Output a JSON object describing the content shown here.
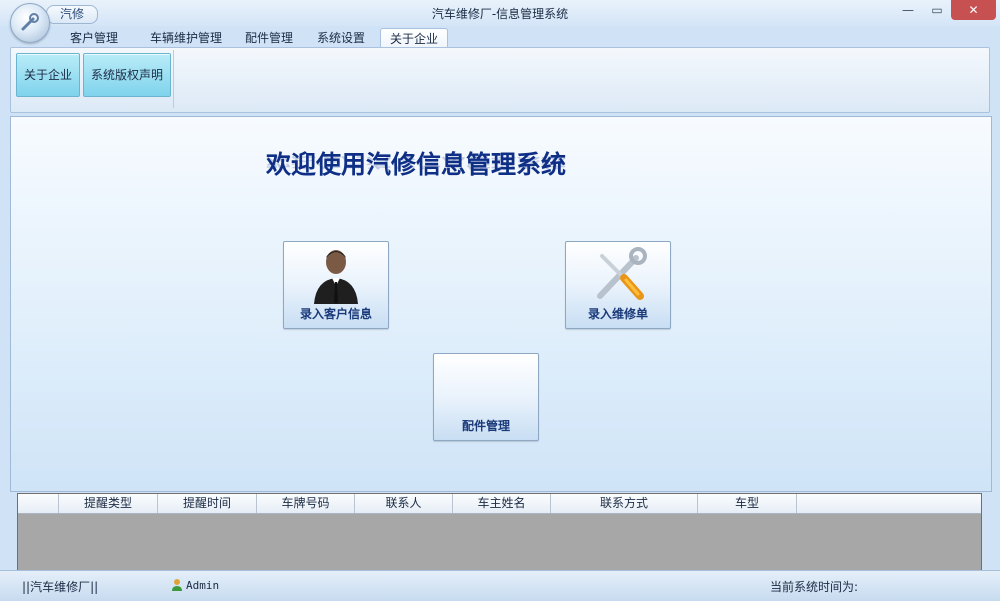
{
  "window": {
    "title": "汽车维修厂-信息管理系统",
    "quick_access_label": "汽修",
    "minimize_symbol": "—",
    "maximize_symbol": "▭",
    "close_symbol": "✕"
  },
  "tabs": [
    {
      "label": "客户管理",
      "active": false
    },
    {
      "label": "车辆维护管理",
      "active": false
    },
    {
      "label": "配件管理",
      "active": false
    },
    {
      "label": "系统设置",
      "active": false
    },
    {
      "label": "关于企业",
      "active": true
    }
  ],
  "ribbon": {
    "buttons": [
      {
        "label": "关于企业"
      },
      {
        "label": "系统版权声明"
      }
    ]
  },
  "main": {
    "welcome": "欢迎使用汽修信息管理系统",
    "buttons": [
      {
        "label": "录入客户信息",
        "icon": "businessman-icon"
      },
      {
        "label": "录入维修单",
        "icon": "tools-icon"
      },
      {
        "label": "配件管理",
        "icon": ""
      }
    ]
  },
  "grid": {
    "columns": [
      "提醒类型",
      "提醒时间",
      "车牌号码",
      "联系人",
      "车主姓名",
      "联系方式",
      "车型"
    ]
  },
  "status": {
    "company": "||汽车维修厂||",
    "user": "Admin",
    "time_label": "当前系统时间为:"
  },
  "colors": {
    "accent": "#0f2f86",
    "ribbon_button": "#7fd3ec",
    "close_button": "#c75050"
  }
}
